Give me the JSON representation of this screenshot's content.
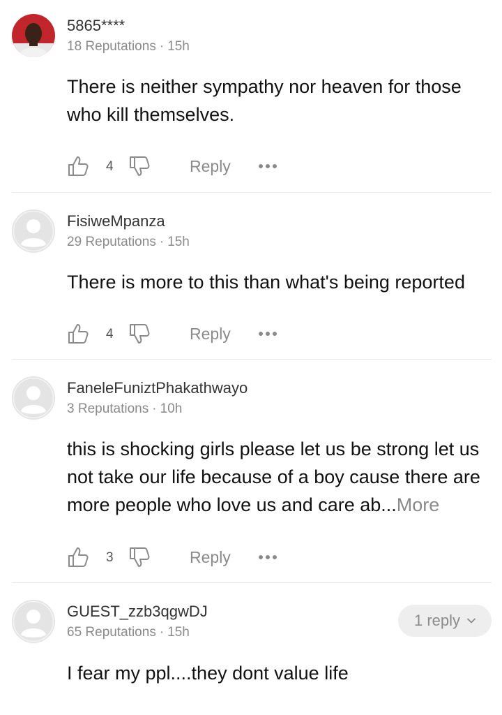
{
  "comments": [
    {
      "username": "5865****",
      "reputation": "18 Reputations",
      "time": "15h",
      "text": "There is neither sympathy nor heaven for those who kill themselves.",
      "likes": "4",
      "reply_label": "Reply",
      "avatar": "user-photo"
    },
    {
      "username": "FisiweMpanza",
      "reputation": "29 Reputations",
      "time": "15h",
      "text": "There is more to this than what's being reported",
      "likes": "4",
      "reply_label": "Reply",
      "avatar": "default-avatar"
    },
    {
      "username": "FaneleFuniztPhakathwayo",
      "reputation": "3 Reputations",
      "time": "10h",
      "text": "this is shocking girls please let us be strong let us not take our life because of a boy cause there are more people who love us and care ab...",
      "more_label": "More",
      "likes": "3",
      "reply_label": "Reply",
      "avatar": "default-avatar"
    },
    {
      "username": "GUEST_zzb3qgwDJ",
      "reputation": "65 Reputations",
      "time": "15h",
      "text": "I fear my ppl....they dont value life",
      "replies_label": "1 reply",
      "avatar": "default-avatar"
    }
  ],
  "separator": "·",
  "colors": {
    "text": "#111111",
    "muted": "#8a8a8a",
    "divider": "#e8e8e8",
    "pill_bg": "#eeeeee"
  },
  "icons": [
    "thumbs-up-icon",
    "thumbs-down-icon",
    "more-dots-icon",
    "chevron-down-icon",
    "default-avatar-icon"
  ]
}
